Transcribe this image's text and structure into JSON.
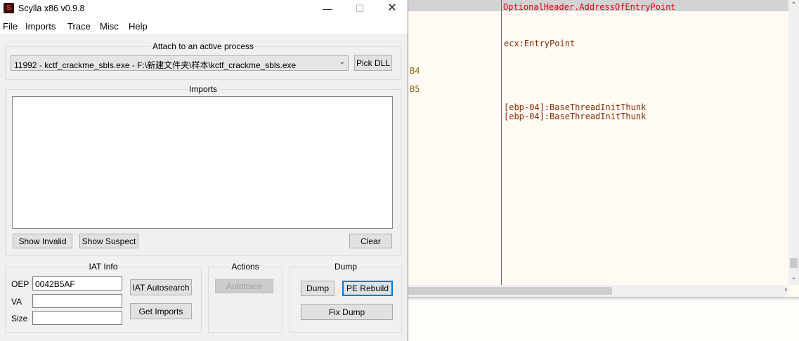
{
  "debugger": {
    "lines": [
      {
        "text": "OptionalHeader.AddressOfEntryPoint",
        "color": "#e0000e"
      },
      {
        "text": "ecx:EntryPoint",
        "color": "#8b2a00"
      },
      {
        "text": "B4",
        "color": "#8b6914"
      },
      {
        "text": "B5",
        "color": "#8b6914"
      },
      {
        "text": "[ebp-04]:BaseThreadInitThunk",
        "color": "#8b2a00"
      },
      {
        "text": "[ebp-04]:BaseThreadInitThunk",
        "color": "#8b2a00"
      }
    ],
    "scroll_right_arrow": "›",
    "scroll_up_arrow": "⌃",
    "scroll_down_arrow": "⌄"
  },
  "window": {
    "title": "Scylla x86 v0.9.8",
    "icon_letter": "S",
    "minimize": "—",
    "maximize": "☐",
    "close": "✕"
  },
  "menu": [
    "File",
    "Imports",
    "Trace",
    "Misc",
    "Help"
  ],
  "attach": {
    "title": "Attach to an active process",
    "selected_process": "11992 - kctf_crackme_sbls.exe - F:\\新建文件夹\\样本\\kctf_crackme_sbls.exe",
    "pick_dll": "Pick DLL"
  },
  "imports": {
    "title": "Imports",
    "show_invalid": "Show Invalid",
    "show_suspect": "Show Suspect",
    "clear": "Clear"
  },
  "iat": {
    "title": "IAT Info",
    "oep_label": "OEP",
    "oep_value": "0042B5AF",
    "va_label": "VA",
    "va_value": "",
    "size_label": "Size",
    "size_value": "",
    "autosearch": "IAT Autosearch",
    "get_imports": "Get Imports"
  },
  "actions": {
    "title": "Actions",
    "autotrace": "Autotrace"
  },
  "dump": {
    "title": "Dump",
    "dump": "Dump",
    "pe_rebuild": "PE Rebuild",
    "fix_dump": "Fix Dump"
  }
}
